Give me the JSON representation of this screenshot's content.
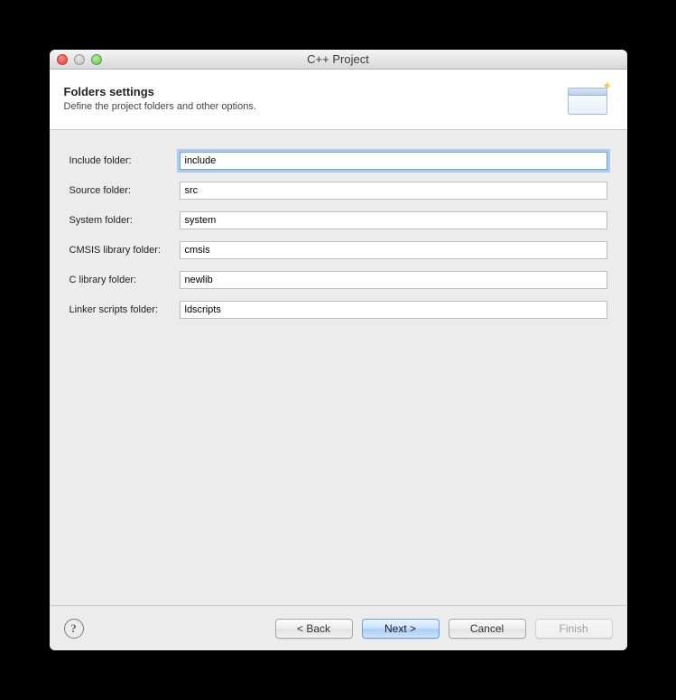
{
  "window": {
    "title": "C++ Project"
  },
  "banner": {
    "heading": "Folders  settings",
    "desc": "Define the project folders and other options."
  },
  "fields": {
    "include": {
      "label": "Include folder:",
      "value": "include"
    },
    "source": {
      "label": "Source folder:",
      "value": "src"
    },
    "system": {
      "label": "System folder:",
      "value": "system"
    },
    "cmsis": {
      "label": "CMSIS library folder:",
      "value": "cmsis"
    },
    "clib": {
      "label": "C library folder:",
      "value": "newlib"
    },
    "linker": {
      "label": "Linker scripts folder:",
      "value": "ldscripts"
    }
  },
  "buttons": {
    "back": "< Back",
    "next": "Next >",
    "cancel": "Cancel",
    "finish": "Finish"
  }
}
